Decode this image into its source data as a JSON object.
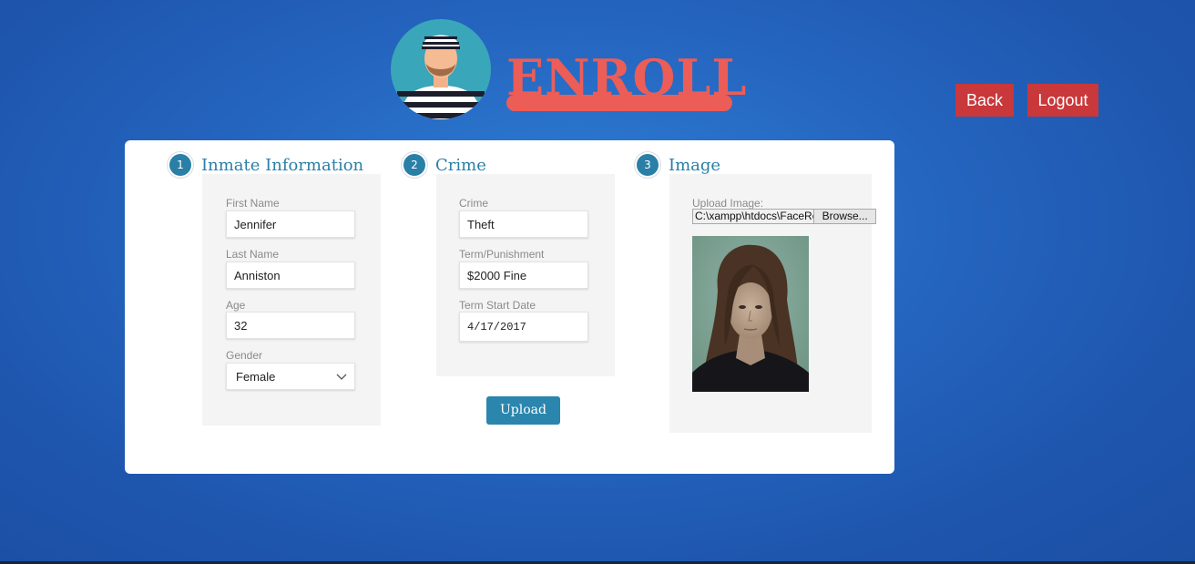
{
  "header": {
    "logo_text": "ENROLL",
    "back_label": "Back",
    "logout_label": "Logout"
  },
  "sections": {
    "inmate": {
      "number": "1",
      "title": "Inmate Information",
      "first_name_label": "First Name",
      "first_name_value": "Jennifer",
      "last_name_label": "Last Name",
      "last_name_value": "Anniston",
      "age_label": "Age",
      "age_value": "32",
      "gender_label": "Gender",
      "gender_value": "Female"
    },
    "crime": {
      "number": "2",
      "title": "Crime",
      "crime_label": "Crime",
      "crime_value": "Theft",
      "term_label": "Term/Punishment",
      "term_value": "$2000 Fine",
      "start_label": "Term Start Date",
      "start_value": "4/17/2017",
      "upload_label": "Upload"
    },
    "image": {
      "number": "3",
      "title": "Image",
      "upload_label": "Upload Image:",
      "file_path": "C:\\xampp\\htdocs\\FaceRe",
      "browse_label": "Browse..."
    }
  },
  "colors": {
    "background": "#2566c0",
    "accent": "#2a7fa6",
    "brand": "#ec5d57",
    "danger": "#c9383a"
  },
  "icons": [
    "inmate-avatar-icon",
    "chevron-down-icon"
  ]
}
